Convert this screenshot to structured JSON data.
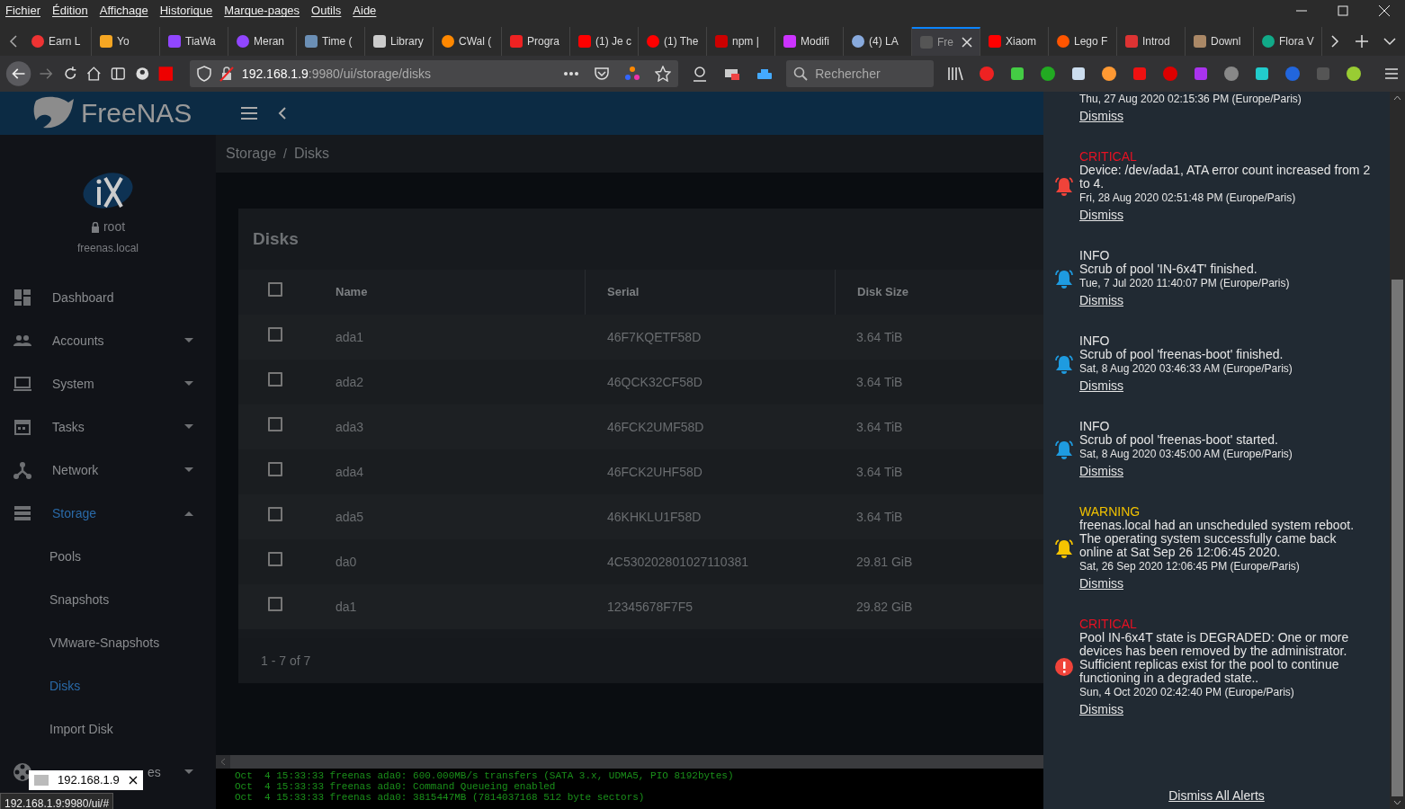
{
  "menu": [
    "Fichier",
    "Édition",
    "Affichage",
    "Historique",
    "Marque-pages",
    "Outils",
    "Aide"
  ],
  "tabs": [
    {
      "label": "Earn L",
      "selected": false
    },
    {
      "label": "Yo",
      "selected": false
    },
    {
      "label": "TiaWa",
      "selected": false
    },
    {
      "label": "Meran",
      "selected": false
    },
    {
      "label": "Time (",
      "selected": false
    },
    {
      "label": "Library",
      "selected": false
    },
    {
      "label": "CWal (",
      "selected": false
    },
    {
      "label": "Progra",
      "selected": false
    },
    {
      "label": "(1) Je c",
      "selected": false
    },
    {
      "label": "(1) The",
      "selected": false
    },
    {
      "label": "npm |",
      "selected": false
    },
    {
      "label": "Modifi",
      "selected": false
    },
    {
      "label": "(4) LA",
      "selected": false
    },
    {
      "label": "Fre",
      "selected": true
    },
    {
      "label": "Xiaom",
      "selected": false
    },
    {
      "label": "Lego F",
      "selected": false
    },
    {
      "label": "Introd",
      "selected": false
    },
    {
      "label": "Downl",
      "selected": false
    },
    {
      "label": "Flora V",
      "selected": false
    }
  ],
  "address": {
    "host": "192.168.1.9",
    "path": ":9980/ui/storage/disks"
  },
  "search": {
    "placeholder": "Rechercher"
  },
  "app": {
    "logo": "FreeNAS",
    "user": "root",
    "hostname": "freenas.local"
  },
  "sidebar": {
    "items": [
      {
        "label": "Dashboard",
        "kind": "dashboard",
        "selected": false
      },
      {
        "label": "Accounts",
        "kind": "accounts",
        "selected": false,
        "expanded": false
      },
      {
        "label": "System",
        "kind": "system",
        "selected": false,
        "expanded": false
      },
      {
        "label": "Tasks",
        "kind": "tasks",
        "selected": false,
        "expanded": false
      },
      {
        "label": "Network",
        "kind": "network",
        "selected": false,
        "expanded": false
      },
      {
        "label": "Storage",
        "kind": "storage",
        "selected": true,
        "expanded": true,
        "children": [
          {
            "label": "Pools",
            "selected": false
          },
          {
            "label": "Snapshots",
            "selected": false
          },
          {
            "label": "VMware-Snapshots",
            "selected": false
          },
          {
            "label": "Disks",
            "selected": true
          },
          {
            "label": "Import Disk",
            "selected": false
          }
        ]
      },
      {
        "label": "es",
        "kind": "directory",
        "selected": false,
        "expanded": false
      }
    ]
  },
  "breadcrumb": {
    "items": [
      "Storage",
      "Disks"
    ],
    "separator": "/"
  },
  "card": {
    "title": "Disks",
    "columns": [
      "Name",
      "Serial",
      "Disk Size"
    ],
    "header_checked": false,
    "rows": [
      {
        "name": "ada1",
        "serial": "46F7KQETF58D",
        "size": "3.64 TiB",
        "checked": false
      },
      {
        "name": "ada2",
        "serial": "46QCK32CF58D",
        "size": "3.64 TiB",
        "checked": false
      },
      {
        "name": "ada3",
        "serial": "46FCK2UMF58D",
        "size": "3.64 TiB",
        "checked": false
      },
      {
        "name": "ada4",
        "serial": "46FCK2UHF58D",
        "size": "3.64 TiB",
        "checked": false
      },
      {
        "name": "ada5",
        "serial": "46KHKLU1F58D",
        "size": "3.64 TiB",
        "checked": false
      },
      {
        "name": "da0",
        "serial": "4C530202801027110381",
        "size": "29.81 GiB",
        "checked": false
      },
      {
        "name": "da1",
        "serial": "12345678F7F5",
        "size": "29.82 GiB",
        "checked": false
      }
    ],
    "pagination": "1 - 7 of 7"
  },
  "console": [
    "Oct  4 15:33:33 freenas ada0: 600.000MB/s transfers (SATA 3.x, UDMA5, PIO 8192bytes)",
    "Oct  4 15:33:33 freenas ada0: Command Queueing enabled",
    "Oct  4 15:33:33 freenas ada0: 3815447MB (7814037168 512 byte sectors)"
  ],
  "alerts": [
    {
      "time": "Thu, 27 Aug 2020 02:15:36 PM (Europe/Paris)",
      "dismiss": "Dismiss"
    },
    {
      "level": "CRITICAL",
      "kind": "bell",
      "message": "Device: /dev/ada1, ATA error count increased from 2 to 4.",
      "time": "Fri, 28 Aug 2020 02:51:48 PM (Europe/Paris)",
      "dismiss": "Dismiss"
    },
    {
      "level": "INFO",
      "kind": "bell",
      "message": "Scrub of pool 'IN-6x4T' finished.",
      "time": "Tue, 7 Jul 2020 11:40:07 PM (Europe/Paris)",
      "dismiss": "Dismiss"
    },
    {
      "level": "INFO",
      "kind": "bell",
      "message": "Scrub of pool 'freenas-boot' finished.",
      "time": "Sat, 8 Aug 2020 03:46:33 AM (Europe/Paris)",
      "dismiss": "Dismiss"
    },
    {
      "level": "INFO",
      "kind": "bell",
      "message": "Scrub of pool 'freenas-boot' started.",
      "time": "Sat, 8 Aug 2020 03:45:00 AM (Europe/Paris)",
      "dismiss": "Dismiss"
    },
    {
      "level": "WARNING",
      "kind": "bell",
      "message": "freenas.local had an unscheduled system reboot. The operating system successfully came back online at Sat Sep 26 12:06:45 2020.",
      "time": "Sat, 26 Sep 2020 12:06:45 PM (Europe/Paris)",
      "dismiss": "Dismiss"
    },
    {
      "level": "CRITICAL",
      "kind": "error",
      "message": "Pool IN-6x4T state is DEGRADED: One or more devices has been removed by the administrator. Sufficient replicas exist for the pool to continue functioning in a degraded state..",
      "time": "Sun, 4 Oct 2020 02:42:40 PM (Europe/Paris)",
      "dismiss": "Dismiss"
    }
  ],
  "dismiss_all": "Dismiss All Alerts",
  "tab_tooltip": {
    "label": "192.168.1.9"
  },
  "status_url": "192.168.1.9:9980/ui/#"
}
